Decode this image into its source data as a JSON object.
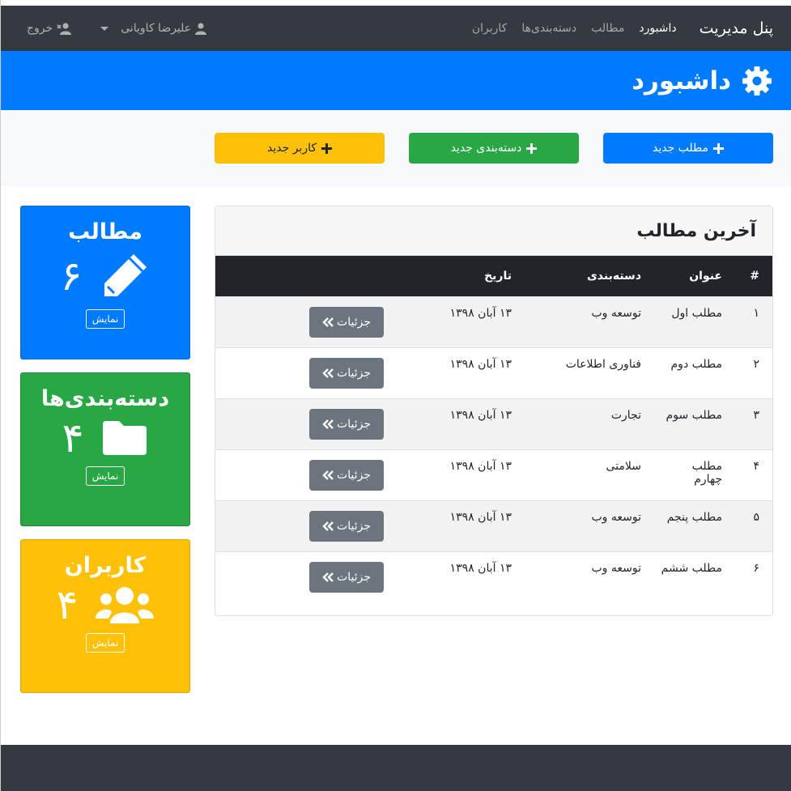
{
  "navbar": {
    "brand": "پنل مدیریت",
    "links": [
      "داشبورد",
      "مطالب",
      "دسته‌بندی‌ها",
      "کاربران"
    ],
    "user": "علیرضا کاویانی",
    "logout": "خروج"
  },
  "header": {
    "title": "داشبورد"
  },
  "actions": {
    "new_post": "مطلب جدید",
    "new_category": "دسته‌بندی جدید",
    "new_user": "کاربر جدید"
  },
  "posts": {
    "title": "آخرین مطالب",
    "columns": [
      "#",
      "عنوان",
      "دسته‌بندی",
      "تاریخ"
    ],
    "rows": [
      {
        "num": "۱",
        "title": "مطلب اول",
        "category": "توسعه وب",
        "date": "۱۳ آبان ۱۳۹۸",
        "button": "جزئیات"
      },
      {
        "num": "۲",
        "title": "مطلب دوم",
        "category": "فناوری اطلاعات",
        "date": "۱۳ آبان ۱۳۹۸",
        "button": "جزئیات"
      },
      {
        "num": "۳",
        "title": "مطلب سوم",
        "category": "تجارت",
        "date": "۱۳ آبان ۱۳۹۸",
        "button": "جزئیات"
      },
      {
        "num": "۴",
        "title": "مطلب چهارم",
        "category": "سلامتی",
        "date": "۱۳ آبان ۱۳۹۸",
        "button": "جزئیات"
      },
      {
        "num": "۵",
        "title": "مطلب پنجم",
        "category": "توسعه وب",
        "date": "۱۳ آبان ۱۳۹۸",
        "button": "جزئیات"
      },
      {
        "num": "۶",
        "title": "مطلب ششم",
        "category": "توسعه وب",
        "date": "۱۳ آبان ۱۳۹۸",
        "button": "جزئیات"
      }
    ]
  },
  "stats": [
    {
      "title": "مطالب",
      "count": "۶",
      "icon": "pencil-icon",
      "show": "نمایش"
    },
    {
      "title": "دسته‌بندی‌ها",
      "count": "۴",
      "icon": "folder-icon",
      "show": "نمایش"
    },
    {
      "title": "کاربران",
      "count": "۴",
      "icon": "users-icon",
      "show": "نمایش"
    }
  ],
  "colors": {
    "primary": "#007bff",
    "success": "#28a745",
    "warning": "#ffc107",
    "dark": "#343a40",
    "secondary": "#6c757d"
  }
}
